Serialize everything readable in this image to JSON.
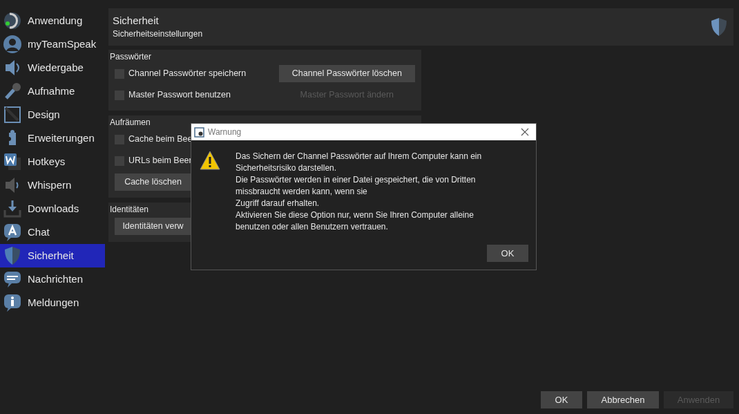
{
  "sidebar": {
    "items": [
      {
        "label": "Anwendung",
        "selected": false
      },
      {
        "label": "myTeamSpeak",
        "selected": false
      },
      {
        "label": "Wiedergabe",
        "selected": false
      },
      {
        "label": "Aufnahme",
        "selected": false
      },
      {
        "label": "Design",
        "selected": false
      },
      {
        "label": "Erweiterungen",
        "selected": false
      },
      {
        "label": "Hotkeys",
        "selected": false
      },
      {
        "label": "Whispern",
        "selected": false
      },
      {
        "label": "Downloads",
        "selected": false
      },
      {
        "label": "Chat",
        "selected": false
      },
      {
        "label": "Sicherheit",
        "selected": true
      },
      {
        "label": "Nachrichten",
        "selected": false
      },
      {
        "label": "Meldungen",
        "selected": false
      }
    ]
  },
  "header": {
    "title": "Sicherheit",
    "subtitle": "Sicherheitseinstellungen"
  },
  "groups": [
    {
      "title": "Passwörter",
      "rows": [
        {
          "checkbox": {
            "label": "Channel Passwörter speichern",
            "checked": false
          },
          "button": {
            "label": "Channel Passwörter löschen",
            "disabled": false
          }
        },
        {
          "checkbox": {
            "label": "Master Passwort benutzen",
            "checked": false
          },
          "button": {
            "label": "Master Passwort ändern",
            "disabled": true
          }
        }
      ]
    },
    {
      "title": "Aufräumen",
      "rows": [
        {
          "checkbox": {
            "label": "Cache beim Bee",
            "checked": false
          }
        },
        {
          "checkbox": {
            "label": "URLs beim Beer",
            "checked": false
          }
        },
        {
          "button": {
            "label": "Cache löschen",
            "disabled": false
          }
        }
      ]
    },
    {
      "title": "Identitäten",
      "rows": [
        {
          "button": {
            "label": "Identitäten verw",
            "disabled": false
          }
        }
      ]
    }
  ],
  "dialog": {
    "title": "Warnung",
    "message": [
      "Das Sichern der Channel Passwörter auf Ihrem Computer kann ein",
      "Sicherheitsrisiko darstellen.",
      "Die Passwörter werden in einer Datei gespeichert, die von Dritten",
      "missbraucht werden kann, wenn sie",
      "Zugriff darauf erhalten.",
      "Aktivieren Sie diese Option nur, wenn Sie Ihren Computer alleine",
      "benutzen oder allen Benutzern vertrauen."
    ],
    "button": "OK"
  },
  "footer": {
    "buttons": [
      {
        "label": "OK",
        "disabled": false
      },
      {
        "label": "Abbrechen",
        "disabled": false
      },
      {
        "label": "Anwenden",
        "disabled": true
      }
    ]
  }
}
